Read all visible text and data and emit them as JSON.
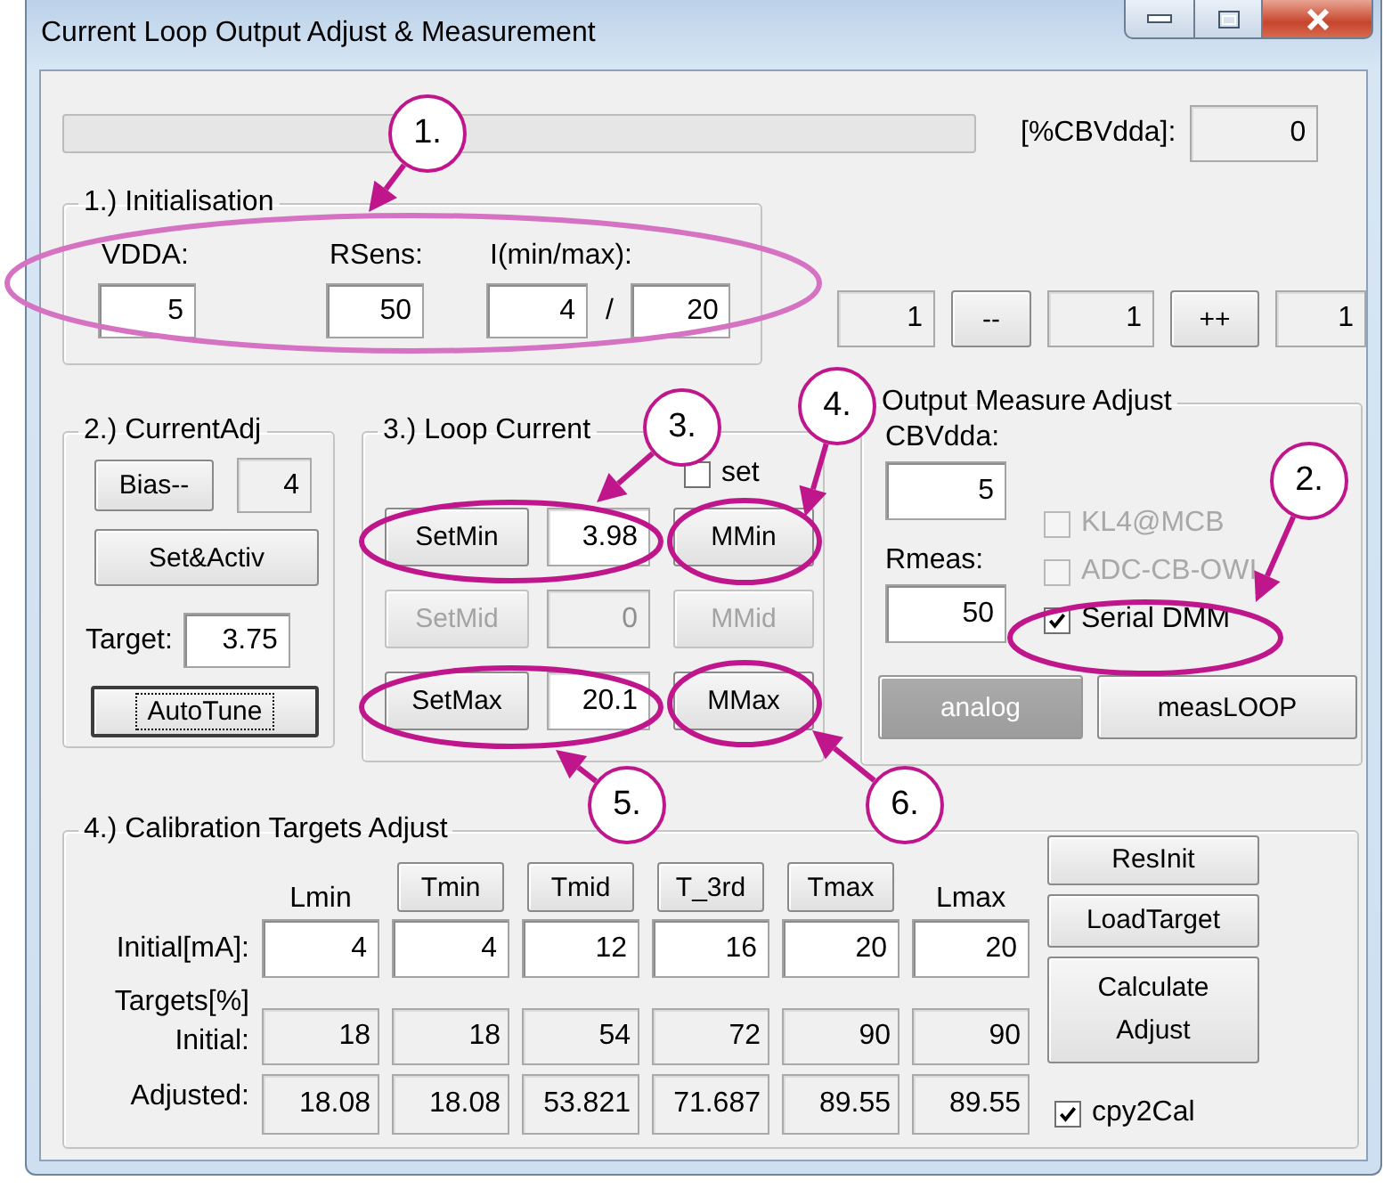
{
  "window": {
    "title": "Current Loop Output Adjust & Measurement"
  },
  "progress": {
    "level": 0
  },
  "cbvdda_percent": {
    "label": "[%CBVdda]:",
    "value": "0"
  },
  "initialisation": {
    "title": "1.) Initialisation",
    "vdda": {
      "label": "VDDA:",
      "value": "5"
    },
    "rsens": {
      "label": "RSens:",
      "value": "50"
    },
    "current_range": {
      "label": "I(min/max):",
      "min": "4",
      "separator": "/",
      "max": "20"
    }
  },
  "counter": [
    {
      "kind": "readout",
      "text": "1"
    },
    {
      "kind": "button",
      "text": "--"
    },
    {
      "kind": "readout",
      "text": "1"
    },
    {
      "kind": "button",
      "text": "++"
    },
    {
      "kind": "readout",
      "text": "1"
    }
  ],
  "current_adj": {
    "title": "2.) CurrentAdj",
    "bias_button": "Bias--",
    "bias_value": "4",
    "set_button": "Set&Activ",
    "target_label": "Target:",
    "target_value": "3.75",
    "autotune_button": {
      "label": "AutoTune",
      "focused": true
    }
  },
  "loop_current": {
    "title": "3.) Loop Current",
    "set_checkbox": {
      "label": "set",
      "checked": false
    },
    "rows": [
      {
        "set_button": "SetMin",
        "value": "3.98",
        "measure_button": "MMin",
        "disabled": false
      },
      {
        "set_button": "SetMid",
        "value": "0",
        "measure_button": "MMid",
        "disabled": true
      },
      {
        "set_button": "SetMax",
        "value": "20.1",
        "measure_button": "MMax",
        "disabled": false
      }
    ]
  },
  "output_measure": {
    "title": "Output Measure Adjust",
    "cbvdda": {
      "label": "CBVdda:",
      "value": "5"
    },
    "rmeas": {
      "label": "Rmeas:",
      "value": "50"
    },
    "options": [
      {
        "label": "KL4@MCB",
        "checked": false,
        "disabled": true
      },
      {
        "label": "ADC-CB-OWI",
        "checked": false,
        "disabled": true
      },
      {
        "label": "Serial DMM",
        "checked": true,
        "disabled": false
      }
    ],
    "buttons": [
      {
        "label": "analog",
        "disabled": true
      },
      {
        "label": "measLOOP",
        "disabled": false
      }
    ]
  },
  "calibration": {
    "title": "4.) Calibration Targets Adjust",
    "columns": [
      {
        "kind": "label",
        "text": "Lmin"
      },
      {
        "kind": "button",
        "text": "Tmin"
      },
      {
        "kind": "button",
        "text": "Tmid"
      },
      {
        "kind": "button",
        "text": "T_3rd"
      },
      {
        "kind": "button",
        "text": "Tmax"
      },
      {
        "kind": "label",
        "text": "Lmax"
      }
    ],
    "rows": [
      {
        "kind": "input",
        "label": "Initial[mA]:",
        "values": [
          "4",
          "4",
          "12",
          "16",
          "20",
          "20"
        ]
      },
      {
        "kind": "readout",
        "label": "Targets[%] Initial:",
        "values": [
          "18",
          "18",
          "54",
          "72",
          "90",
          "90"
        ]
      },
      {
        "kind": "readout",
        "label": "Adjusted:",
        "values": [
          "18.08",
          "18.08",
          "53.821",
          "71.687",
          "89.55",
          "89.55"
        ]
      }
    ],
    "buttons": [
      "ResInit",
      "LoadTarget",
      "Calculate Adjust"
    ],
    "cpy2cal": {
      "label": "cpy2Cal",
      "checked": true
    }
  },
  "annotations": [
    {
      "label": "1."
    },
    {
      "label": "2."
    },
    {
      "label": "3."
    },
    {
      "label": "4."
    },
    {
      "label": "5."
    },
    {
      "label": "6."
    }
  ]
}
